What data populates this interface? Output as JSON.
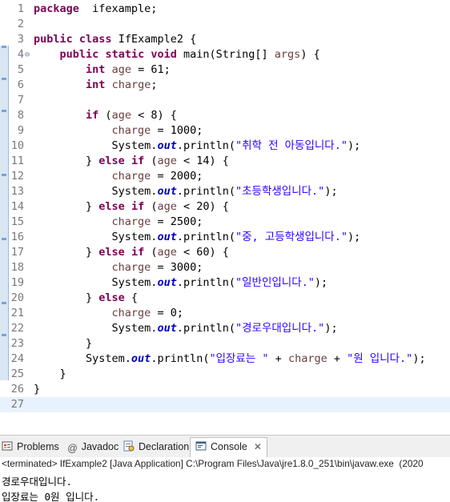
{
  "editor": {
    "lines": [
      {
        "n": "1",
        "t": [
          [
            "kw",
            "package"
          ],
          [
            "",
            "  ifexample;"
          ]
        ]
      },
      {
        "n": "2",
        "t": []
      },
      {
        "n": "3",
        "t": [
          [
            "kw",
            "public"
          ],
          [
            "",
            " "
          ],
          [
            "kw",
            "class"
          ],
          [
            "",
            " IfExample2 {"
          ]
        ]
      },
      {
        "n": "4",
        "fold": "⊖",
        "t": [
          [
            "",
            "    "
          ],
          [
            "kw",
            "public"
          ],
          [
            "",
            " "
          ],
          [
            "kw",
            "static"
          ],
          [
            "",
            " "
          ],
          [
            "kw",
            "void"
          ],
          [
            "",
            " main(String[] "
          ],
          [
            "var",
            "args"
          ],
          [
            "",
            ") {"
          ]
        ]
      },
      {
        "n": "5",
        "t": [
          [
            "",
            "        "
          ],
          [
            "kw",
            "int"
          ],
          [
            "",
            " "
          ],
          [
            "var",
            "age"
          ],
          [
            "",
            " = 61;"
          ]
        ]
      },
      {
        "n": "6",
        "t": [
          [
            "",
            "        "
          ],
          [
            "kw",
            "int"
          ],
          [
            "",
            " "
          ],
          [
            "var",
            "charge"
          ],
          [
            "",
            ";"
          ]
        ]
      },
      {
        "n": "7",
        "t": []
      },
      {
        "n": "8",
        "t": [
          [
            "",
            "        "
          ],
          [
            "kw",
            "if"
          ],
          [
            "",
            " ("
          ],
          [
            "var",
            "age"
          ],
          [
            "",
            " < 8) {"
          ]
        ]
      },
      {
        "n": "9",
        "t": [
          [
            "",
            "            "
          ],
          [
            "var",
            "charge"
          ],
          [
            "",
            " = 1000;"
          ]
        ]
      },
      {
        "n": "10",
        "t": [
          [
            "",
            "            System."
          ],
          [
            "fld",
            "out"
          ],
          [
            "",
            ".println("
          ],
          [
            "str",
            "\"취학 전 아동입니다.\""
          ],
          [
            "",
            ");"
          ]
        ]
      },
      {
        "n": "11",
        "t": [
          [
            "",
            "        } "
          ],
          [
            "kw",
            "else"
          ],
          [
            "",
            " "
          ],
          [
            "kw",
            "if"
          ],
          [
            "",
            " ("
          ],
          [
            "var",
            "age"
          ],
          [
            "",
            " < 14) {"
          ]
        ]
      },
      {
        "n": "12",
        "t": [
          [
            "",
            "            "
          ],
          [
            "var",
            "charge"
          ],
          [
            "",
            " = 2000;"
          ]
        ]
      },
      {
        "n": "13",
        "t": [
          [
            "",
            "            System."
          ],
          [
            "fld",
            "out"
          ],
          [
            "",
            ".println("
          ],
          [
            "str",
            "\"초등학생입니다.\""
          ],
          [
            "",
            ");"
          ]
        ]
      },
      {
        "n": "14",
        "t": [
          [
            "",
            "        } "
          ],
          [
            "kw",
            "else"
          ],
          [
            "",
            " "
          ],
          [
            "kw",
            "if"
          ],
          [
            "",
            " ("
          ],
          [
            "var",
            "age"
          ],
          [
            "",
            " < 20) {"
          ]
        ]
      },
      {
        "n": "15",
        "t": [
          [
            "",
            "            "
          ],
          [
            "var",
            "charge"
          ],
          [
            "",
            " = 2500;"
          ]
        ]
      },
      {
        "n": "16",
        "t": [
          [
            "",
            "            System."
          ],
          [
            "fld",
            "out"
          ],
          [
            "",
            ".println("
          ],
          [
            "str",
            "\"중, 고등학생입니다.\""
          ],
          [
            "",
            ");"
          ]
        ]
      },
      {
        "n": "17",
        "t": [
          [
            "",
            "        } "
          ],
          [
            "kw",
            "else"
          ],
          [
            "",
            " "
          ],
          [
            "kw",
            "if"
          ],
          [
            "",
            " ("
          ],
          [
            "var",
            "age"
          ],
          [
            "",
            " < 60) {"
          ]
        ]
      },
      {
        "n": "18",
        "t": [
          [
            "",
            "            "
          ],
          [
            "var",
            "charge"
          ],
          [
            "",
            " = 3000;"
          ]
        ]
      },
      {
        "n": "19",
        "t": [
          [
            "",
            "            System."
          ],
          [
            "fld",
            "out"
          ],
          [
            "",
            ".println("
          ],
          [
            "str",
            "\"일반인입니다.\""
          ],
          [
            "",
            ");"
          ]
        ]
      },
      {
        "n": "20",
        "t": [
          [
            "",
            "        } "
          ],
          [
            "kw",
            "else"
          ],
          [
            "",
            " {"
          ]
        ]
      },
      {
        "n": "21",
        "t": [
          [
            "",
            "            "
          ],
          [
            "var",
            "charge"
          ],
          [
            "",
            " = 0;"
          ]
        ]
      },
      {
        "n": "22",
        "t": [
          [
            "",
            "            System."
          ],
          [
            "fld",
            "out"
          ],
          [
            "",
            ".println("
          ],
          [
            "str",
            "\"경로우대입니다.\""
          ],
          [
            "",
            ");"
          ]
        ]
      },
      {
        "n": "23",
        "t": [
          [
            "",
            "        }"
          ]
        ]
      },
      {
        "n": "24",
        "t": [
          [
            "",
            "        System."
          ],
          [
            "fld",
            "out"
          ],
          [
            "",
            ".println("
          ],
          [
            "str",
            "\"입장료는 \""
          ],
          [
            "",
            " + "
          ],
          [
            "var",
            "charge"
          ],
          [
            "",
            " + "
          ],
          [
            "str",
            "\"원 입니다.\""
          ],
          [
            "",
            ");"
          ]
        ]
      },
      {
        "n": "25",
        "t": [
          [
            "",
            "    }"
          ]
        ]
      },
      {
        "n": "26",
        "t": [
          [
            "",
            "}"
          ]
        ]
      },
      {
        "n": "27",
        "t": [],
        "current": true
      }
    ]
  },
  "tabs": {
    "problems": "Problems",
    "javadoc": "Javadoc",
    "declaration": "Declaration",
    "console": "Console"
  },
  "console": {
    "header": "<terminated> IfExample2 [Java Application] C:\\Program Files\\Java\\jre1.8.0_251\\bin\\javaw.exe  (2020",
    "output": [
      "경로우대입니다.",
      "입장료는 0원 입니다."
    ]
  },
  "colors": {
    "keyword": "#7f0055",
    "string": "#2a00ff",
    "field": "#0000c0",
    "local_var": "#6a3e3e",
    "current_line": "#e8f2fe"
  }
}
